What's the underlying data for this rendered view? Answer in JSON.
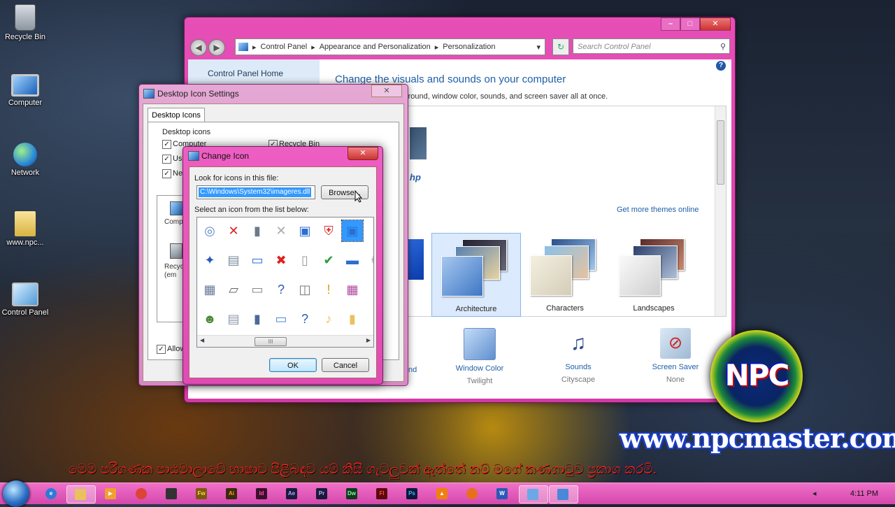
{
  "desktop": {
    "icons": [
      {
        "label": "Recycle Bin",
        "icon": "recycle-bin-icon"
      },
      {
        "label": "Computer",
        "icon": "computer-icon"
      },
      {
        "label": "Network",
        "icon": "network-icon"
      },
      {
        "label": "www.npc...",
        "icon": "user-folder-icon"
      },
      {
        "label": "Control Panel",
        "icon": "control-panel-icon"
      }
    ]
  },
  "control_panel": {
    "breadcrumb": [
      "Control Panel",
      "Appearance and Personalization",
      "Personalization"
    ],
    "search_placeholder": "Search Control Panel",
    "sidebar_home": "Control Panel Home",
    "title": "Change the visuals and sounds on your computer",
    "subtitle": "ge the desktop background, window color, sounds, and screen saver all at once.",
    "get_more": "Get more themes online",
    "themes": [
      {
        "label": "Architecture",
        "selected": true
      },
      {
        "label": "Characters",
        "selected": false
      },
      {
        "label": "Landscapes",
        "selected": false
      }
    ],
    "bottom": {
      "background_partial": "nd",
      "window_color": {
        "label": "Window Color",
        "value": "Twilight"
      },
      "sounds": {
        "label": "Sounds",
        "value": "Cityscape"
      },
      "screen_saver": {
        "label": "Screen Saver",
        "value": "None"
      }
    },
    "help": "?"
  },
  "desktop_icon_settings": {
    "title": "Desktop Icon Settings",
    "tab": "Desktop Icons",
    "group_label": "Desktop icons",
    "checkboxes": [
      {
        "label": "Computer",
        "checked": true
      },
      {
        "label": "Us",
        "checked": true
      },
      {
        "label": "Ne",
        "checked": true
      },
      {
        "label": "Recycle Bin",
        "checked": true
      }
    ],
    "icon_labels": [
      "Comp",
      "Recyc",
      "(em"
    ],
    "allow_label": "Allow"
  },
  "change_icon": {
    "title": "Change Icon",
    "look_label": "Look for icons in this file:",
    "file_path": "C:\\Windows\\System32\\imageres.dll",
    "browse": "Browse...",
    "select_label": "Select an icon from the list below:",
    "ok": "OK",
    "cancel": "Cancel",
    "scroll_thumb": "III"
  },
  "branding": {
    "logo": "NPC",
    "site": "www.npcmaster.com",
    "banner": "මෙම පරිගණක පාඨමාලාවේ භාෂාව පිළිබඳව යම් කිසි ගැටලුවක් ඇත්තේ නම් මගේ කණගාටුව ප්‍රකාශ කරමි."
  },
  "taskbar": {
    "time": "4:11 PM",
    "tray_arrow": "◂"
  }
}
